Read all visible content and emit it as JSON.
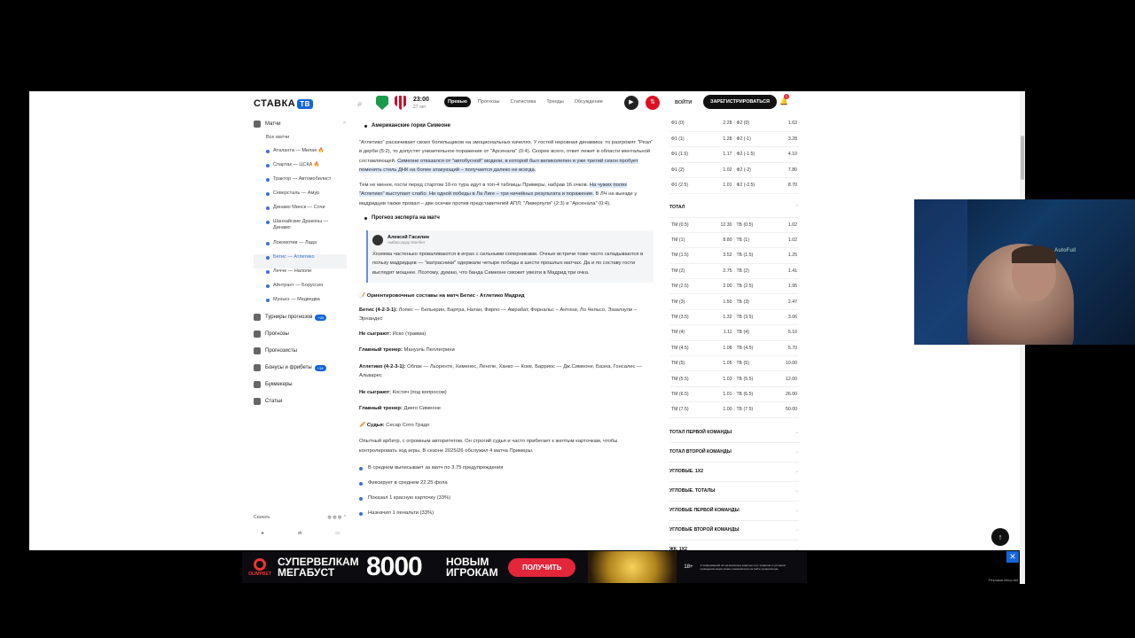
{
  "header": {
    "logo": "СТАВКА",
    "logo_badge": "ТВ",
    "match_time": "23:00",
    "match_date": "27 окт",
    "tabs": [
      "Превью",
      "Прогнозы",
      "Статистика",
      "Тренды",
      "Обсуждение"
    ],
    "active_tab": "Превью",
    "login": "ВОЙТИ",
    "register": "ЗАРЕГИСТРИРОВАТЬСЯ",
    "notif_count": "1",
    "team_colors": {
      "home": "#1a9a4a",
      "away": "#c8102e"
    }
  },
  "sidebar": {
    "matches_label": "Матчи",
    "all_matches": "Все матчи",
    "matches": [
      {
        "label": "Аталанта — Милан 🔥",
        "active": false
      },
      {
        "label": "Спартак — ЦСКА 🔥",
        "active": false
      },
      {
        "label": "Трактор — Автомобилист",
        "active": false
      },
      {
        "label": "Северсталь — Амур",
        "active": false
      },
      {
        "label": "Динамо Минск — Сочи",
        "active": false
      },
      {
        "label": "Шанхайские Драконы — Динамо",
        "active": false
      },
      {
        "label": "Локомотив — Лада",
        "active": false
      },
      {
        "label": "Бетис — Атлетико",
        "active": true
      },
      {
        "label": "Лечче — Наполи",
        "active": false
      },
      {
        "label": "Айнтрахт — Боруссия",
        "active": false
      },
      {
        "label": "Мунькэ — Медведва",
        "active": false
      }
    ],
    "sections": [
      {
        "label": "Турниры прогнозов",
        "badge": "+20"
      },
      {
        "label": "Прогнозы",
        "badge": ""
      },
      {
        "label": "Прогнозисты",
        "badge": ""
      },
      {
        "label": "Бонусы и фрибеты",
        "badge": "+16"
      },
      {
        "label": "Букмекеры",
        "badge": ""
      },
      {
        "label": "Статьи",
        "badge": ""
      }
    ],
    "download": "Скачать"
  },
  "article": {
    "h1": "Американские горки Симеоне",
    "p1a": "\"Атлетико\" раскачивает своих болельщиков на эмоциональных качелях. У гостей неровная динамика: то разгромят \"Реал\" в дерби (5:2), то допустят унизительное поражение от \"Арсенала\" (0:4). Скорее всего, ответ лежит в области ментальной составляющей. ",
    "p1b": "Симеоне отказался от \"автобусной\" модели, в которой был великолепен и уже третий сезон пробует поменять стиль ДНК на более атакующий – получается далеко не всегда.",
    "p2a": "Тем не менее, гости перед стартом 10-го тура идут в топ-4 таблицы Примеры, набрав 16 очков. ",
    "p2b": "На чужих полях \"Атлетико\" выступает слабо. Ни одной победы в Ла Лиге – три ничейных результата и поражение.",
    "p2c": " В ЛЧ на выезде у мадридцев также провал – две осечки против представителей АПЛ: \"Ливерпуля\" (2:3) и \"Арсенала\" (0:4).",
    "h2": "Прогноз эксперта на матч",
    "expert_name": "Алексей Гасилин",
    "expert_role": "Амбассадор Мелбет",
    "expert_text": "Хозяева частенько проваливаются в играх с сильными соперниками. Очные встречи тоже часто складываются в пользу мадридцев — \"матрасники\" одержали четыре победы в шести прошлых матчах. Да и по составу гости выглядят мощнее. Поэтому, думаю, что банда Симеоне сможет увезти в Мадрид три очка.",
    "lineups_title": "📝 Ориентировочные составы на матч Бетис - Атлетико Мадрид",
    "betis_label": "Бетис (4-2-3-1):",
    "betis_lineup": " Лопес — Бельерин, Бартра, Натан, Фирпо — Амрабат, Форнальс – Антони, Ло Чельсо, Эззалзули – Эрнандес",
    "out_label": "Не сыграют:",
    "betis_out": " Иско (травма)",
    "coach_label": "Главный тренер:",
    "betis_coach": " Мануэль Пеллегрини",
    "atl_label": "Атлетико (4-2-3-1):",
    "atl_lineup": " Облак — Льоренте, Хименес, Ленглe, Ханко — Коке, Барриос — Дж.Симеоне, Баэна, Гонсалес — Альварес",
    "atl_out": " Костич (под вопросом)",
    "atl_coach": " Диего Симеоне",
    "ref_label": "🥖 Судья:",
    "ref_name": " Сесар Сото Градо",
    "ref_text": "Опытный арбитр, с огромным авторитетом. Он строгий судья и часто прибегает к желтым карточкам, чтобы контролировать ход игры. В сезоне 2025/26 обслужил 4 матча Примеры.",
    "bullets": [
      "В среднем выписывает за матч по 3.75 предупреждения",
      "Фиксирует в среднем 22.25 фола",
      "Показал 1 красную карточку (33%)",
      "Назначил 1 пенальти (33%)"
    ]
  },
  "odds": {
    "handicap_rows": [
      [
        "Ф1 (0)",
        "2.28",
        "Ф2 (0)",
        "1.63"
      ],
      [
        "Ф1 (1)",
        "1.28",
        "Ф2 (-1)",
        "3.28"
      ],
      [
        "Ф1 (1.5)",
        "1.17",
        "Ф2 (-1.5)",
        "4.10"
      ],
      [
        "Ф1 (2)",
        "1.02",
        "Ф2 (-2)",
        "7.80"
      ],
      [
        "Ф1 (2.5)",
        "1.01",
        "Ф2 (-2.5)",
        "8.70"
      ]
    ],
    "total_label": "ТОТАЛ",
    "total_rows": [
      [
        "ТМ (0.5)",
        "12.30",
        "ТБ (0.5)",
        "1.02"
      ],
      [
        "ТМ (1)",
        "8.80",
        "ТБ (1)",
        "1.02"
      ],
      [
        "ТМ (1.5)",
        "3.52",
        "ТБ (1.5)",
        "1.25"
      ],
      [
        "ТМ (2)",
        "2.75",
        "ТБ (2)",
        "1.41"
      ],
      [
        "ТМ (2.5)",
        "2.00",
        "ТБ (2.5)",
        "1.95"
      ],
      [
        "ТМ (3)",
        "1.50",
        "ТБ (3)",
        "2.47"
      ],
      [
        "ТМ (3.5)",
        "1.32",
        "ТБ (3.5)",
        "3.06"
      ],
      [
        "ТМ (4)",
        "1.11",
        "ТБ (4)",
        "5.10"
      ],
      [
        "ТМ (4.5)",
        "1.08",
        "ТБ (4.5)",
        "5.70"
      ],
      [
        "ТМ (5)",
        "1.05",
        "ТБ (5)",
        "10.00"
      ],
      [
        "ТМ (5.5)",
        "1.03",
        "ТБ (5.5)",
        "12.00"
      ],
      [
        "ТМ (6.5)",
        "1.01",
        "ТБ (6.5)",
        "26.00"
      ],
      [
        "ТМ (7.5)",
        "1.00",
        "ТБ (7.5)",
        "50.00"
      ]
    ],
    "sections": [
      "ТОТАЛ ПЕРВОЙ КОМАНДЫ",
      "ТОТАЛ ВТОРОЙ КОМАНДЫ",
      "УГЛОВЫЕ. 1Х2",
      "УГЛОВЫЕ. ТОТАЛЫ",
      "УГЛОВЫЕ ПЕРВОЙ КОМАНДЫ",
      "УГЛОВЫЕ ВТОРОЙ КОМАНДЫ",
      "ЖК. 1Х2"
    ]
  },
  "webcam": {
    "overlay_text": "AutoFull"
  },
  "banner": {
    "brand": "OLIMPBET",
    "line1": "СУПЕРВЕЛКАМ",
    "line2": "МЕГАБУСТ",
    "amount": "8000",
    "line3": "НОВЫМ",
    "line4": "ИГРОКАМ",
    "cta": "ПОЛУЧИТЬ",
    "age": "18+",
    "legal": "С информацией об организаторе азартных игр, правилах и условиях проведения акции можно ознакомиться на сайте организатора.",
    "ad_label": "Реклама olimp.bet",
    "close": "✕"
  }
}
